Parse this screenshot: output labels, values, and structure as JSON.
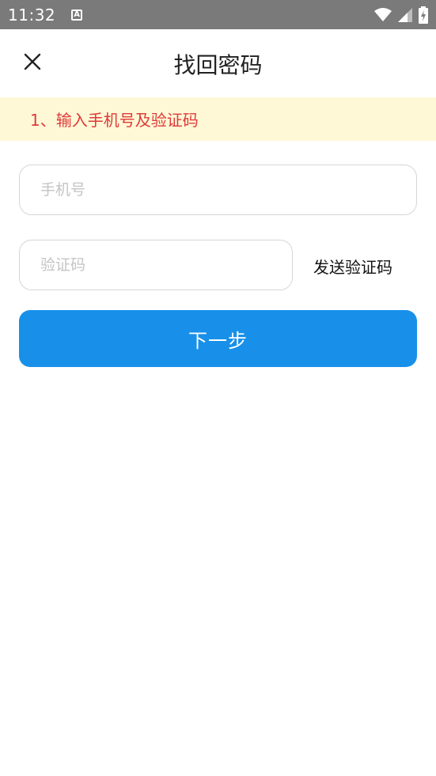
{
  "status_bar": {
    "time": "11:32",
    "icons": [
      "notification-a-icon",
      "wifi-icon",
      "signal-icon",
      "battery-charging-icon"
    ]
  },
  "header": {
    "title": "找回密码",
    "close_icon": "close-icon"
  },
  "step": {
    "text": "1、输入手机号及验证码"
  },
  "form": {
    "phone_placeholder": "手机号",
    "code_placeholder": "验证码",
    "send_code_label": "发送验证码",
    "next_label": "下一步"
  },
  "colors": {
    "status_bar": "#7a7a7a",
    "banner_bg": "#fef8d6",
    "banner_text": "#e03a3a",
    "primary": "#1890e9",
    "input_border": "#d6d6d6"
  }
}
